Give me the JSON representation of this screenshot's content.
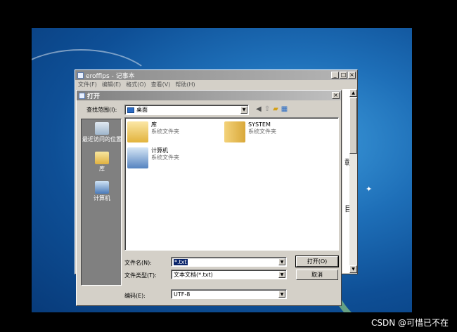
{
  "notepad": {
    "title": "erofflps - 记事本",
    "menu": [
      "文件(F)",
      "编辑(E)",
      "格式(O)",
      "查看(V)",
      "帮助(H)"
    ],
    "side_chars": [
      "彰",
      "目"
    ]
  },
  "dialog": {
    "title": "打开",
    "look_in_label": "查找范围(I):",
    "look_in_value": "桌面",
    "places": [
      {
        "label": "最近访问的位置",
        "icon": "recent-places-icon"
      },
      {
        "label": "库",
        "icon": "library-icon"
      },
      {
        "label": "计算机",
        "icon": "computer-icon"
      }
    ],
    "files": [
      {
        "name": "库",
        "type": "系统文件夹",
        "icon": "library-folder-icon"
      },
      {
        "name": "SYSTEM",
        "type": "系统文件夹",
        "icon": "user-folder-icon"
      },
      {
        "name": "计算机",
        "type": "系统文件夹",
        "icon": "computer-icon"
      }
    ],
    "filename_label": "文件名(N):",
    "filename_value": "*.txt",
    "filetype_label": "文件类型(T):",
    "filetype_value": "文本文档(*.txt)",
    "encoding_label": "编码(E):",
    "encoding_value": "UTF-8",
    "open_button": "打开(O)",
    "cancel_button": "取消"
  },
  "watermark": "CSDN @可惜已不在",
  "colors": {
    "title_bar": "#808080",
    "dialog_face": "#d4d0c8",
    "selection": "#0a246a",
    "desktop": "#1e6fb8"
  }
}
